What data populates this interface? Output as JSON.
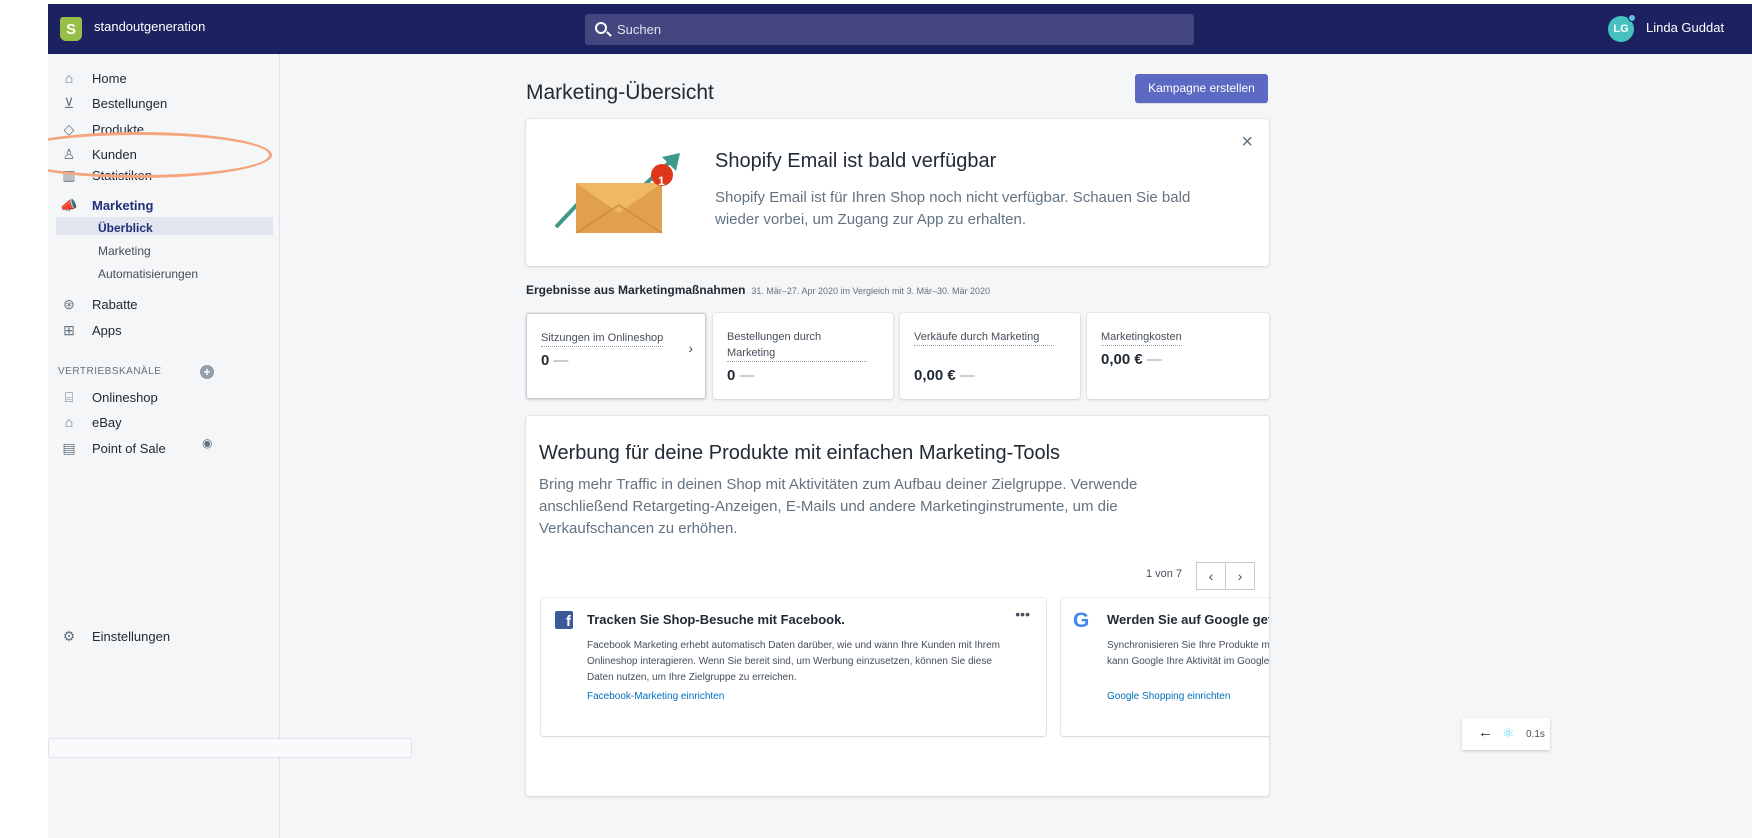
{
  "header": {
    "store_name": "standoutgeneration",
    "search_placeholder": "Suchen",
    "avatar_initials": "LG",
    "user_name": "Linda Guddat"
  },
  "sidebar": {
    "items": [
      {
        "label": "Home",
        "icon": "home-icon"
      },
      {
        "label": "Bestellungen",
        "icon": "orders-icon"
      },
      {
        "label": "Produkte",
        "icon": "tag-icon"
      },
      {
        "label": "Kunden",
        "icon": "person-icon"
      },
      {
        "label": "Statistiken",
        "icon": "bar-chart-icon"
      },
      {
        "label": "Marketing",
        "icon": "megaphone-icon"
      }
    ],
    "marketing_sub": [
      "Überblick",
      "Marketing",
      "Automatisierungen"
    ],
    "items2": [
      {
        "label": "Rabatte",
        "icon": "discount-icon"
      },
      {
        "label": "Apps",
        "icon": "apps-icon"
      }
    ],
    "sales_channels_heading": "VERTRIEBSKANÄLE",
    "channels": [
      {
        "label": "Onlineshop",
        "icon": "store-icon"
      },
      {
        "label": "eBay",
        "icon": "bag-icon"
      },
      {
        "label": "Point of Sale",
        "icon": "pos-icon"
      }
    ],
    "settings": "Einstellungen"
  },
  "main": {
    "title": "Marketing-Übersicht",
    "create_campaign": "Kampagne erstellen",
    "banner": {
      "title": "Shopify Email ist bald verfügbar",
      "text": "Shopify Email ist für Ihren Shop noch nicht verfügbar. Schauen Sie bald wieder vorbei, um Zugang zur App zu erhalten.",
      "badge": "1",
      "close": "×"
    },
    "results": {
      "heading": "Ergebnisse aus Marketingmaßnahmen",
      "daterange": "31. Mär–27. Apr 2020 im Vergleich mit 3. Mär–30. Mär 2020"
    },
    "metrics": [
      {
        "label": "Sitzungen im Onlineshop",
        "value": "0",
        "delta": "—"
      },
      {
        "label": "Bestellungen durch Marketing",
        "value": "0",
        "delta": "—"
      },
      {
        "label": "Verkäufe durch Marketing",
        "value": "0,00 €",
        "delta": "—"
      },
      {
        "label": "Marketingkosten",
        "value": "0,00 €",
        "delta": "—"
      }
    ],
    "promo": {
      "title": "Werbung für deine Produkte mit einfachen Marketing-Tools",
      "text": "Bring mehr Traffic in deinen Shop mit Aktivitäten zum Aufbau deiner Zielgruppe. Verwende anschließend Retargeting-Anzeigen, E-Mails und andere Marketinginstrumente, um die Verkaufschancen zu erhöhen.",
      "pager": "1 von 7",
      "prev": "‹",
      "next": "›"
    },
    "tools": [
      {
        "title": "Tracken Sie Shop-Besuche mit Facebook.",
        "text": "Facebook Marketing erhebt automatisch Daten darüber, wie und wann Ihre Kunden mit Ihrem Onlineshop interagieren. Wenn Sie bereit sind, um Werbung einzusetzen, können Sie diese Daten nutzen, um Ihre Zielgruppe zu erreichen.",
        "link": "Facebook-Marketing einrichten"
      },
      {
        "title": "Werden Sie auf Google gefunden",
        "text": "Synchronisieren Sie Ihre Produkte mit Google. Wenn Sie bereit sind, um Werbung einzusetzen, kann Google Ihre Aktivität im Google-Netzwerk",
        "link": "Google Shopping einrichten"
      }
    ],
    "more": "•••"
  },
  "perf": {
    "arrow": "←",
    "time": "0.1s"
  },
  "colors": {
    "topbar": "#1c2260",
    "accent": "#5c6ac4",
    "highlight_oval": "#f4a57c"
  }
}
